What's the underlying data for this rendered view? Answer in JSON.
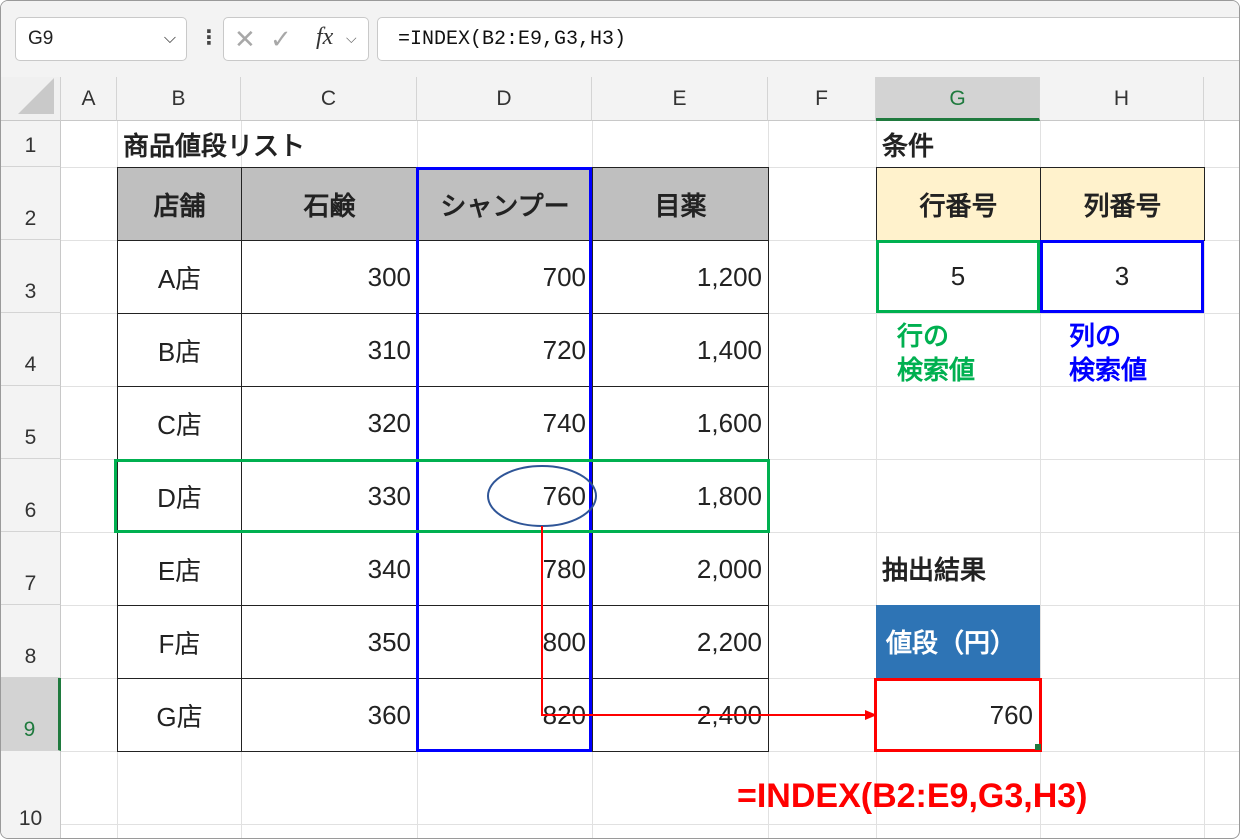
{
  "formula_bar": {
    "name_box": "G9",
    "fx_label": "fx",
    "formula": "=INDEX(B2:E9,G3,H3)"
  },
  "columns": [
    "A",
    "B",
    "C",
    "D",
    "E",
    "F",
    "G",
    "H"
  ],
  "rows": [
    "1",
    "2",
    "3",
    "4",
    "5",
    "6",
    "7",
    "8",
    "9",
    "10"
  ],
  "sheet": {
    "title": "商品値段リスト",
    "table_headers": [
      "店舗",
      "石鹸",
      "シャンプー",
      "目薬"
    ],
    "table_rows": [
      [
        "A店",
        "300",
        "700",
        "1,200"
      ],
      [
        "B店",
        "310",
        "720",
        "1,400"
      ],
      [
        "C店",
        "320",
        "740",
        "1,600"
      ],
      [
        "D店",
        "330",
        "760",
        "1,800"
      ],
      [
        "E店",
        "340",
        "780",
        "2,000"
      ],
      [
        "F店",
        "350",
        "800",
        "2,200"
      ],
      [
        "G店",
        "360",
        "820",
        "2,400"
      ]
    ],
    "conditions_label": "条件",
    "row_number_header": "行番号",
    "col_number_header": "列番号",
    "row_number_value": "5",
    "col_number_value": "3",
    "row_lookup_label_1": "行の",
    "row_lookup_label_2": "検索値",
    "col_lookup_label_1": "列の",
    "col_lookup_label_2": "検索値",
    "result_label": "抽出結果",
    "price_header": "値段（円）",
    "result_value": "760",
    "formula_note": "=INDEX(B2:E9,G3,H3)"
  },
  "colors": {
    "green_highlight": "#00b050",
    "blue_highlight": "#0000ff",
    "red_highlight": "#ff0000",
    "price_header_bg": "#2e74b5",
    "condition_header_bg": "#fff2cc",
    "table_header_bg": "#bfbfbf"
  }
}
